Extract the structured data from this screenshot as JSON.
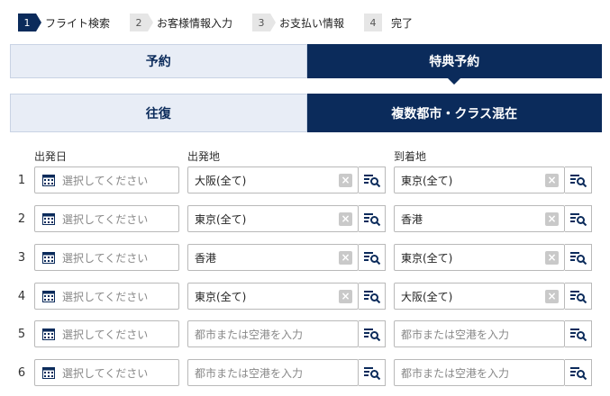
{
  "steps": [
    {
      "num": "1",
      "label": "フライト検索"
    },
    {
      "num": "2",
      "label": "お客様情報入力"
    },
    {
      "num": "3",
      "label": "お支払い情報"
    },
    {
      "num": "4",
      "label": "完了"
    }
  ],
  "booking_tabs": [
    {
      "label": "予約",
      "active": false
    },
    {
      "label": "特典予約",
      "active": true
    }
  ],
  "trip_tabs": [
    {
      "label": "往復",
      "active": false
    },
    {
      "label": "複数都市・クラス混在",
      "active": true
    }
  ],
  "columns": {
    "date": "出発日",
    "departure": "出発地",
    "arrival": "到着地"
  },
  "date_placeholder": "選択してください",
  "city_placeholder": "都市または空港を入力",
  "rows": [
    {
      "num": "1",
      "departure": "大阪(全て)",
      "arrival": "東京(全て)"
    },
    {
      "num": "2",
      "departure": "東京(全て)",
      "arrival": "香港"
    },
    {
      "num": "3",
      "departure": "香港",
      "arrival": "東京(全て)"
    },
    {
      "num": "4",
      "departure": "東京(全て)",
      "arrival": "大阪(全て)"
    },
    {
      "num": "5",
      "departure": "",
      "arrival": ""
    },
    {
      "num": "6",
      "departure": "",
      "arrival": ""
    }
  ],
  "colors": {
    "primary": "#0b2b5b",
    "inactive_tab": "#e8edf6",
    "border": "#b9b9b9"
  }
}
